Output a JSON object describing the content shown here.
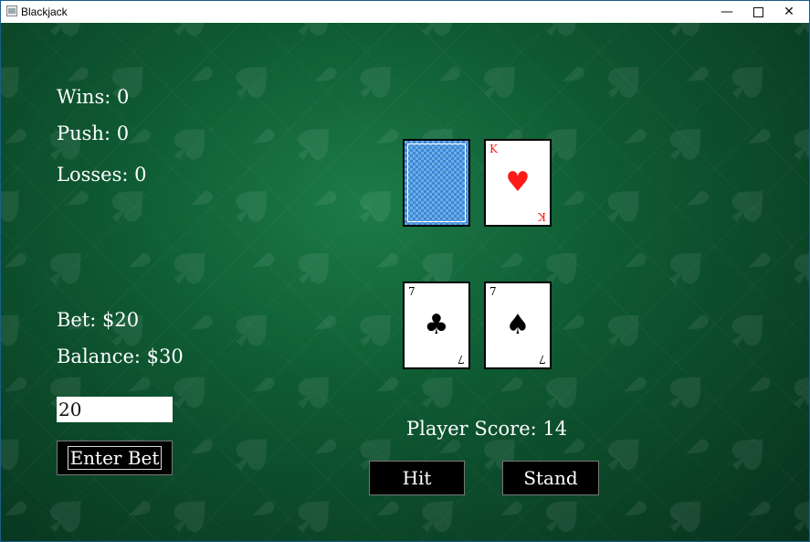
{
  "window": {
    "title": "Blackjack"
  },
  "stats": {
    "wins": "Wins: 0",
    "push": "Push: 0",
    "losses": "Losses: 0"
  },
  "bet": {
    "label": "Bet: $20",
    "balance": "Balance: $30",
    "input_value": "20",
    "enter_label": "Enter Bet"
  },
  "dealer": {
    "cards": [
      {
        "face": "down"
      },
      {
        "face": "up",
        "rank": "K",
        "suit": "♥",
        "color": "#ff1a1a"
      }
    ]
  },
  "player": {
    "cards": [
      {
        "rank": "7",
        "suit": "♣",
        "color": "#000000"
      },
      {
        "rank": "7",
        "suit": "♠",
        "color": "#000000"
      }
    ],
    "score": "Player Score: 14"
  },
  "actions": {
    "hit": "Hit",
    "stand": "Stand"
  }
}
